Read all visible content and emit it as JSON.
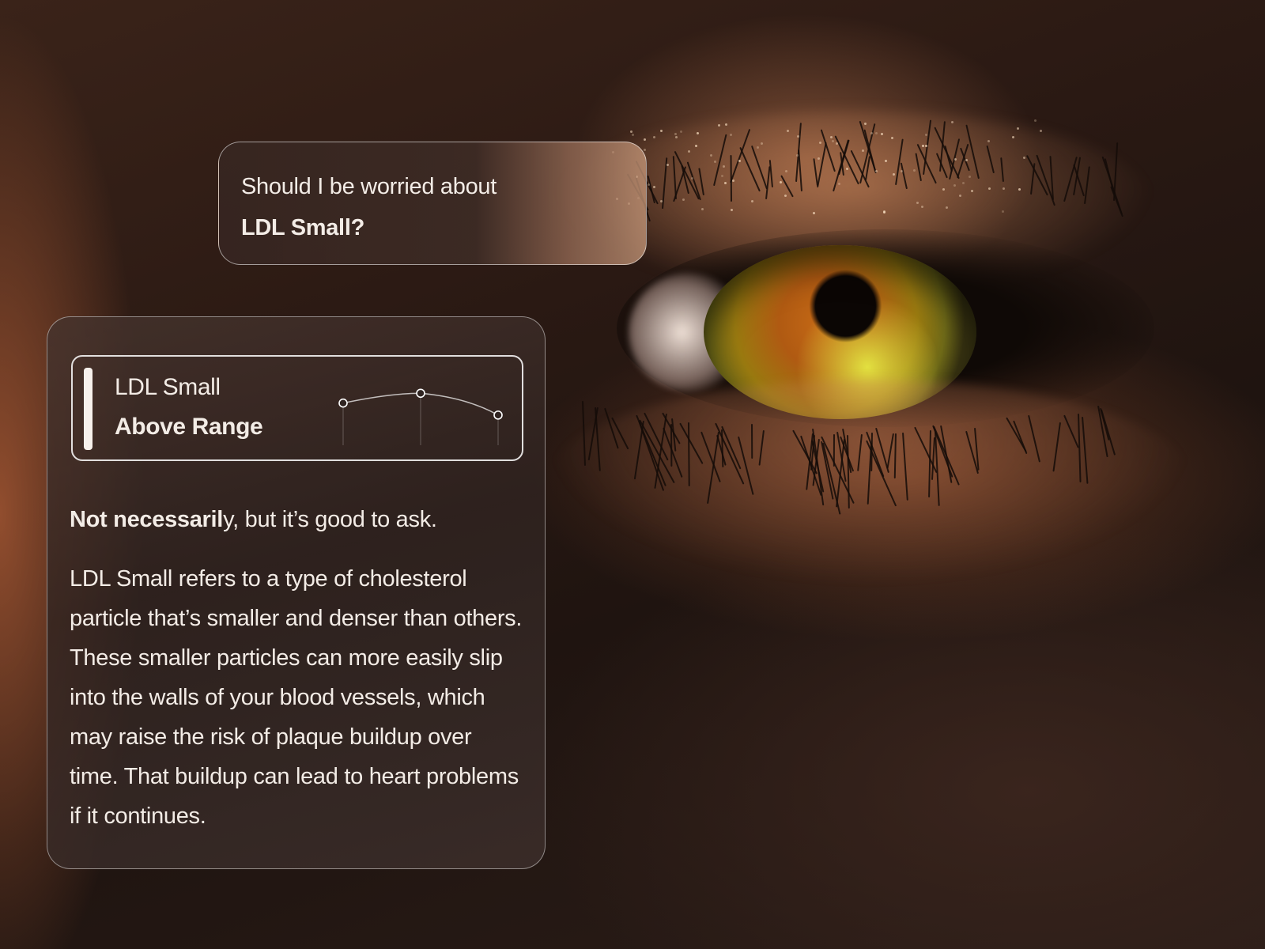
{
  "question": {
    "line1": "Should I be worried about",
    "line2": "LDL Small?"
  },
  "metric": {
    "name": "LDL Small",
    "status": "Above Range",
    "trend_values": [
      0.55,
      0.82,
      0.22
    ]
  },
  "answer": {
    "lead_bold": "Not necessaril",
    "lead_rest": "y, but it’s good to ask.",
    "body": "LDL Small refers to a type of cholesterol particle that’s smaller and denser than others. These smaller particles can more easily slip into the walls of your blood vessels, which may raise the risk of plaque buildup over time. That buildup can lead to heart problems if it continues."
  },
  "colors": {
    "card_border": "#ffffff",
    "text": "#f3ece6",
    "status_bar": "#f7f1ec"
  }
}
